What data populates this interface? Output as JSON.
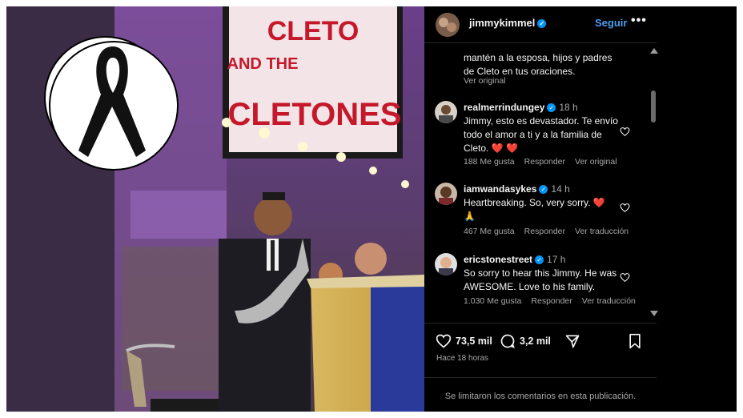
{
  "post": {
    "username": "jimmykimmel",
    "follow_label": "Seguir",
    "more_label": "•••",
    "marquee_line1": "CLETO",
    "marquee_line2": "AND THE",
    "marquee_line3": "CLETONES"
  },
  "comments": [
    {
      "text": "mantén a la esposa, hijos y padres de Cleto en tus oraciones.",
      "see_original": "Ver original"
    },
    {
      "username": "realmerrindungey",
      "time": "18 h",
      "text": "Jimmy, esto es devastador. Te envío todo el amor a ti y a la familia de Cleto.",
      "emoji": "❤️ ❤️",
      "likes": "188 Me gusta",
      "reply": "Responder",
      "see_original": "Ver original"
    },
    {
      "username": "iamwandasykes",
      "time": "14 h",
      "text": "Heartbreaking. So, very sorry.",
      "emoji": "❤️",
      "emoji2": "🙏",
      "likes": "467 Me gusta",
      "reply": "Responder",
      "translate": "Ver traducción"
    },
    {
      "username": "ericstonestreet",
      "time": "17 h",
      "text": "So sorry to hear this Jimmy. He was AWESOME. Love to his family.",
      "likes": "1.030 Me gusta",
      "reply": "Responder",
      "translate": "Ver traducción"
    }
  ],
  "actions": {
    "likes_count": "73,5 mil",
    "comments_count": "3,2 mil",
    "posted_time": "Hace 18 horas"
  },
  "footer": {
    "limited_comments": "Se limitaron los comentarios en esta publicación."
  }
}
